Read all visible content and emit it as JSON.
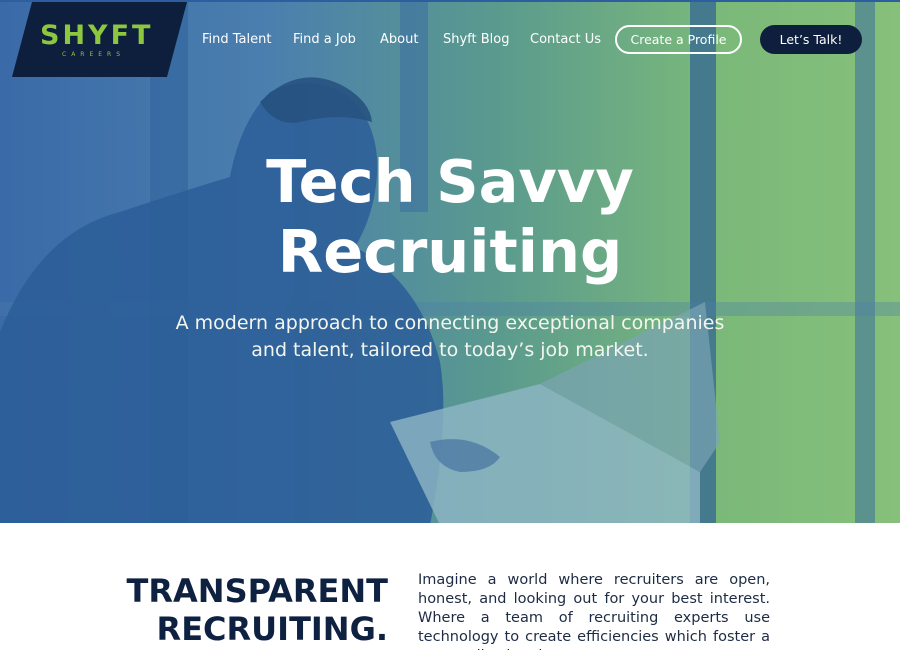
{
  "brand": {
    "name": "SHYFT",
    "sub": "CAREERS",
    "colors": {
      "navy": "#0d1f3c",
      "green": "#8dc63f",
      "blue": "#3a6aa8"
    }
  },
  "nav": {
    "links": [
      "Find Talent",
      "Find a Job",
      "About",
      "Shyft Blog",
      "Contact Us"
    ],
    "create_profile": "Create a Profile",
    "lets_talk": "Let’s Talk!"
  },
  "hero": {
    "title_line1": "Tech Savvy",
    "title_line2": "Recruiting",
    "subtitle_line1": "A modern approach to connecting exceptional companies",
    "subtitle_line2": "and talent, tailored to today’s job market."
  },
  "section": {
    "heading_line1": "TRANSPARENT",
    "heading_line2": "RECRUITING.",
    "paragraph": "Imagine a world where recruiters are open, honest, and looking out for your best interest. Where a team of recruiting experts use technology to create efficiencies which foster a personalized and"
  }
}
